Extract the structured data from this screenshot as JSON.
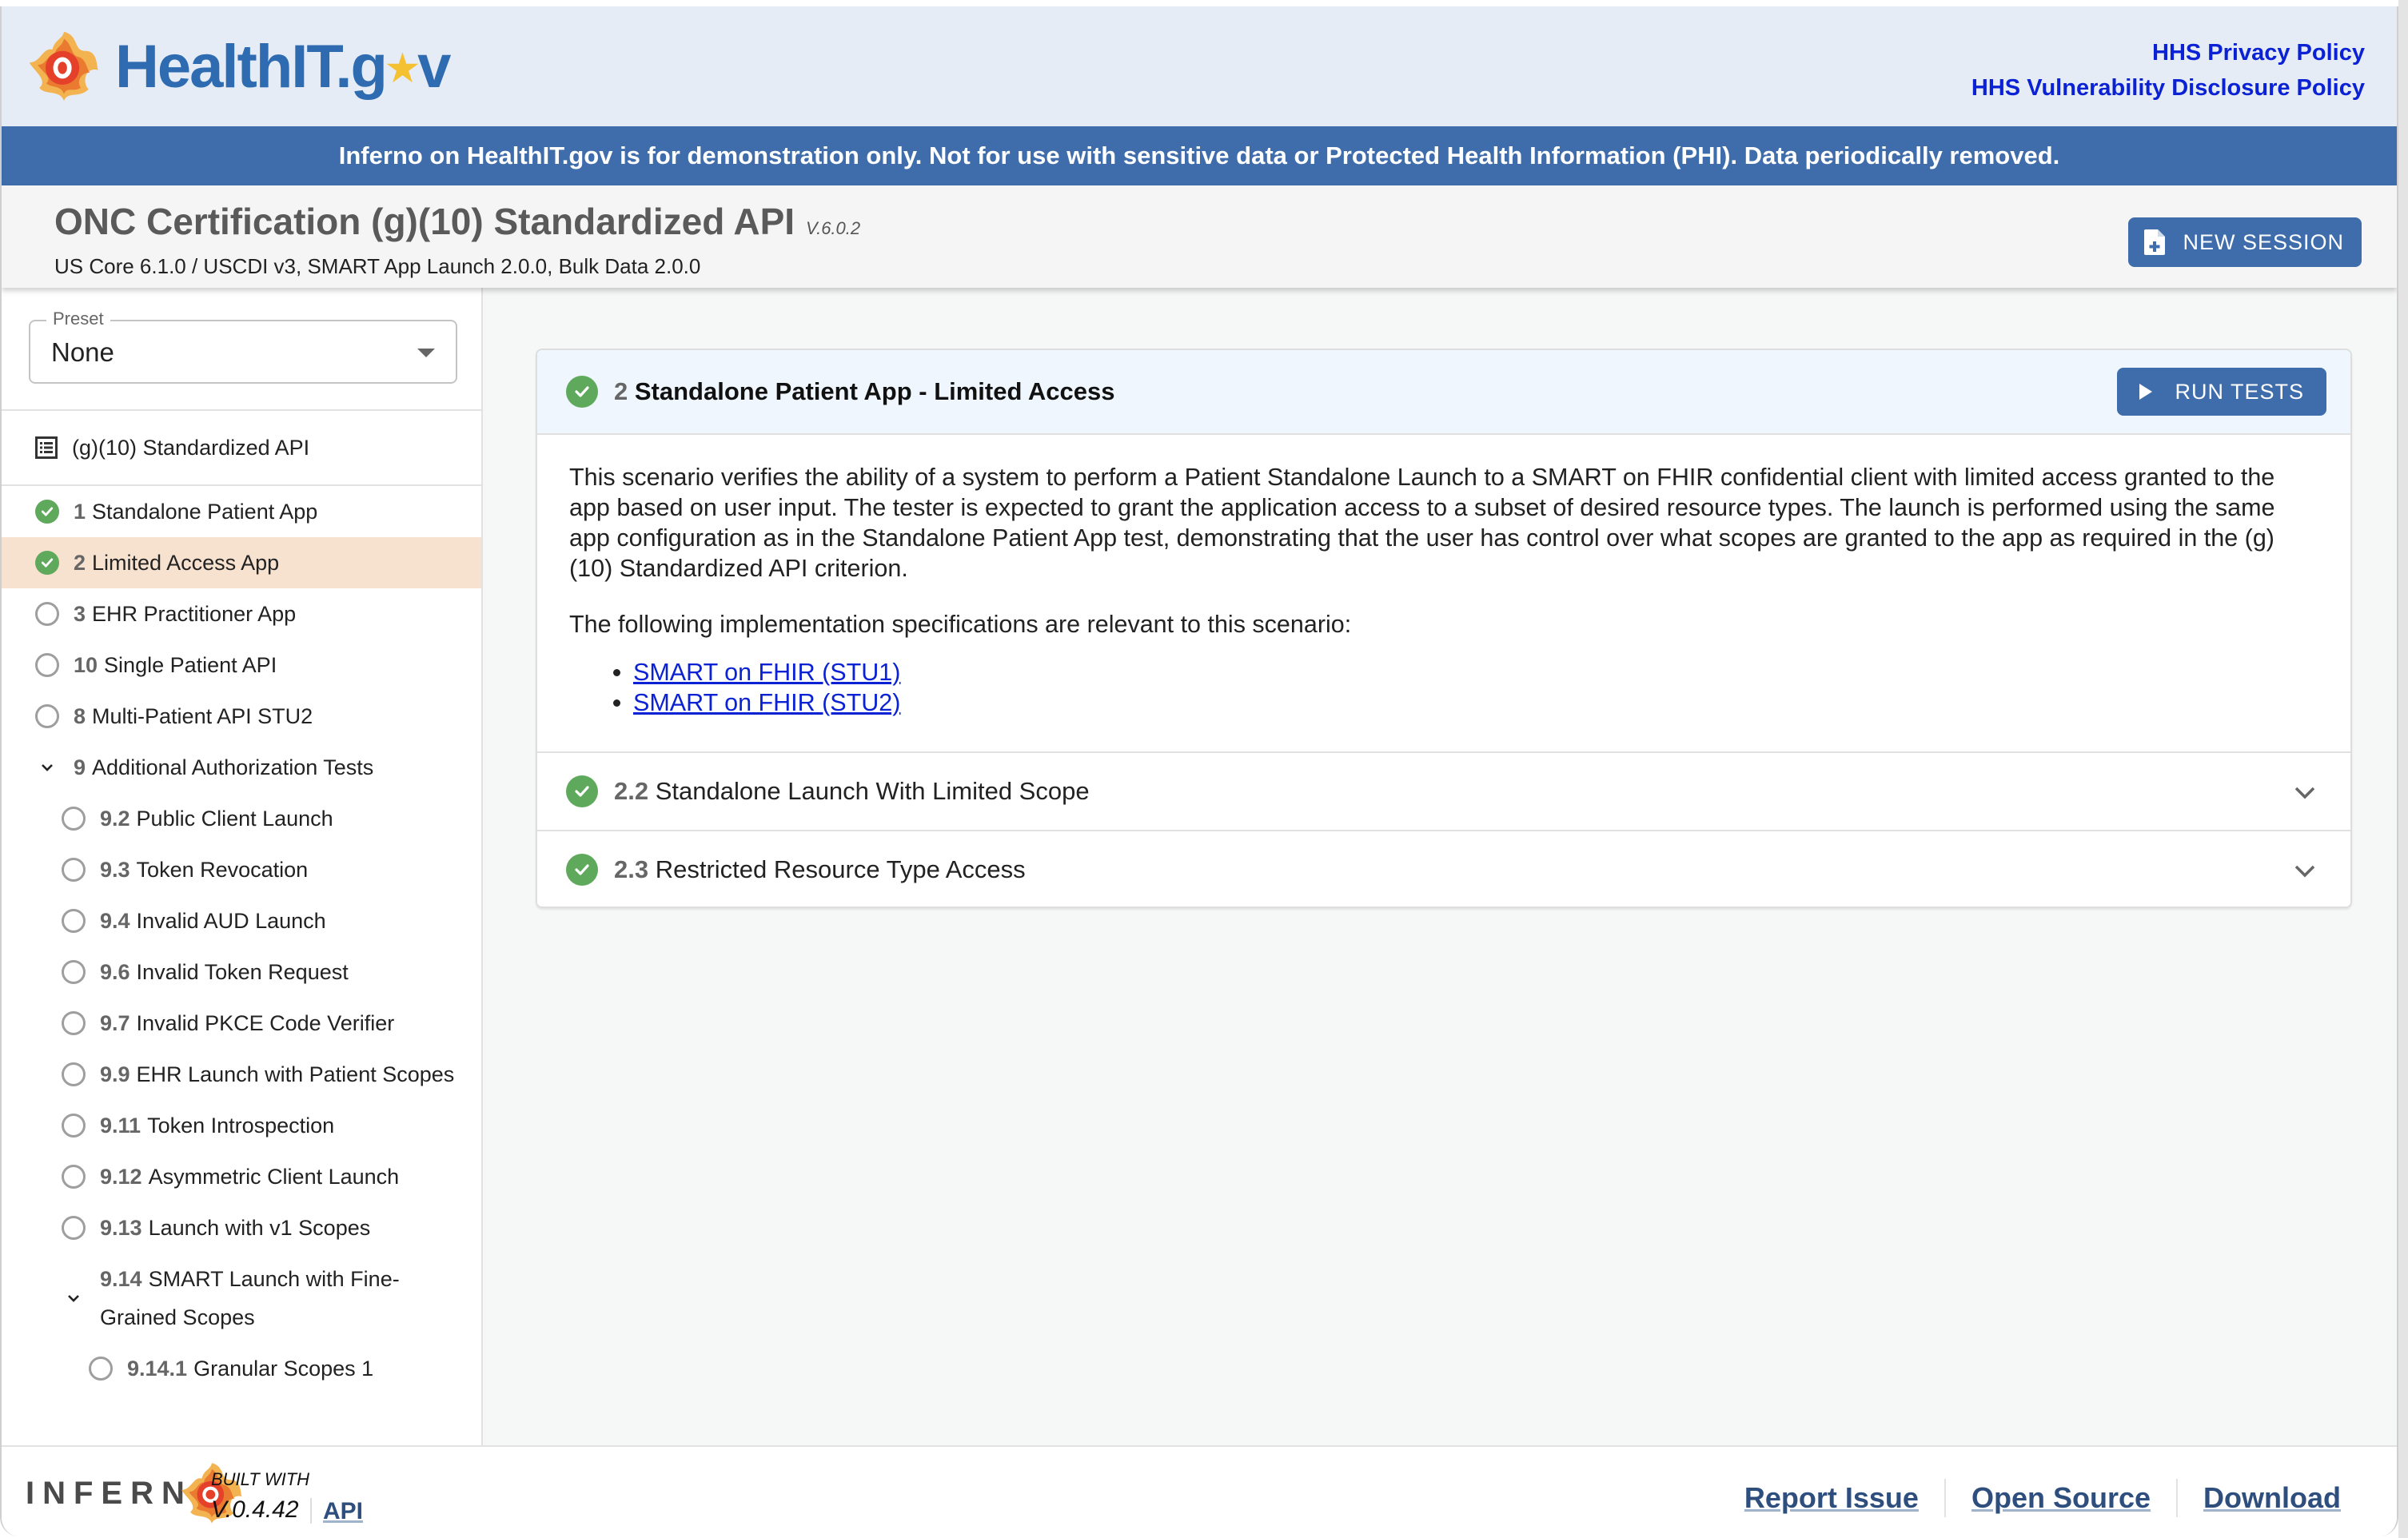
{
  "header": {
    "brand_name": "HealthIT.gov",
    "links": [
      "HHS Privacy Policy",
      "HHS Vulnerability Disclosure Policy"
    ]
  },
  "banner": {
    "text": "Inferno on HealthIT.gov is for demonstration only. Not for use with sensitive data or Protected Health Information (PHI). Data periodically removed."
  },
  "title_bar": {
    "title": "ONC Certification (g)(10) Standardized API",
    "version": "V.6.0.2",
    "subtitle": "US Core 6.1.0 / USCDI v3, SMART App Launch 2.0.0, Bulk Data 2.0.0",
    "new_session_label": "NEW SESSION"
  },
  "sidebar": {
    "preset": {
      "label": "Preset",
      "value": "None"
    },
    "suite_label": "(g)(10) Standardized API",
    "items": [
      {
        "num": "1",
        "label": "Standalone Patient App",
        "status": "pass",
        "level": 0
      },
      {
        "num": "2",
        "label": "Limited Access App",
        "status": "pass",
        "level": 0,
        "active": true
      },
      {
        "num": "3",
        "label": "EHR Practitioner App",
        "status": "none",
        "level": 0
      },
      {
        "num": "10",
        "label": "Single Patient API",
        "status": "none",
        "level": 0
      },
      {
        "num": "8",
        "label": "Multi-Patient API STU2",
        "status": "none",
        "level": 0
      },
      {
        "num": "9",
        "label": "Additional Authorization Tests",
        "status": "expanded",
        "level": 0
      },
      {
        "num": "9.2",
        "label": "Public Client Launch",
        "status": "none",
        "level": 1
      },
      {
        "num": "9.3",
        "label": "Token Revocation",
        "status": "none",
        "level": 1
      },
      {
        "num": "9.4",
        "label": "Invalid AUD Launch",
        "status": "none",
        "level": 1
      },
      {
        "num": "9.6",
        "label": "Invalid Token Request",
        "status": "none",
        "level": 1
      },
      {
        "num": "9.7",
        "label": "Invalid PKCE Code Verifier",
        "status": "none",
        "level": 1
      },
      {
        "num": "9.9",
        "label": "EHR Launch with Patient Scopes",
        "status": "none",
        "level": 1
      },
      {
        "num": "9.11",
        "label": "Token Introspection",
        "status": "none",
        "level": 1
      },
      {
        "num": "9.12",
        "label": "Asymmetric Client Launch",
        "status": "none",
        "level": 1
      },
      {
        "num": "9.13",
        "label": "Launch with v1 Scopes",
        "status": "none",
        "level": 1
      },
      {
        "num": "9.14",
        "label": "SMART Launch with Fine-Grained Scopes",
        "status": "expanded",
        "level": 1
      },
      {
        "num": "9.14.1",
        "label": "Granular Scopes 1",
        "status": "none",
        "level": 2
      }
    ]
  },
  "main": {
    "group": {
      "num": "2",
      "title": "Standalone Patient App - Limited Access",
      "status": "pass",
      "run_tests_label": "RUN TESTS",
      "description": "This scenario verifies the ability of a system to perform a Patient Standalone Launch to a SMART on FHIR confidential client with limited access granted to the app based on user input. The tester is expected to grant the application access to a subset of desired resource types. The launch is performed using the same app configuration as in the Standalone Patient App test, demonstrating that the user has control over what scopes are granted to the app as required in the (g)(10) Standardized API criterion.",
      "specs_intro": "The following implementation specifications are relevant to this scenario:",
      "spec_links": [
        "SMART on FHIR (STU1)",
        "SMART on FHIR (STU2)"
      ]
    },
    "tests": [
      {
        "num": "2.2",
        "title": "Standalone Launch With Limited Scope",
        "status": "pass"
      },
      {
        "num": "2.3",
        "title": "Restricted Resource Type Access",
        "status": "pass"
      }
    ]
  },
  "footer": {
    "logo_text": "INFERN",
    "built_with": "BUILT WITH",
    "version": "V.0.4.42",
    "api_label": "API",
    "links": [
      "Report Issue",
      "Open Source",
      "Download"
    ]
  },
  "colors": {
    "brand_blue": "#3f6dab",
    "pass_green": "#5fa95c",
    "active_item": "#f7e1cf",
    "link_blue": "#0b22d4"
  }
}
